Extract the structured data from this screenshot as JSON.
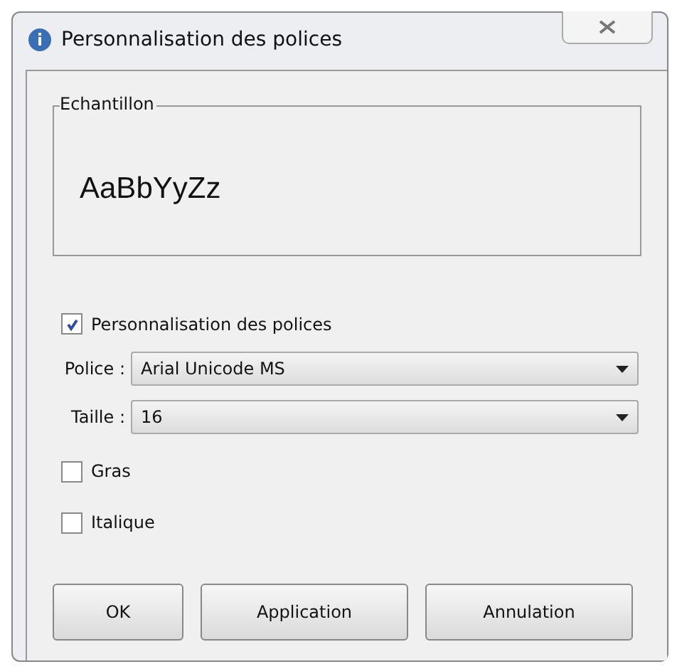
{
  "window": {
    "title": "Personnalisation des polices"
  },
  "sample": {
    "legend": "Echantillon",
    "text": "AaBbYyZz"
  },
  "custom_fonts": {
    "label": "Personnalisation des polices",
    "checked": true
  },
  "fields": [
    {
      "label": "Police :",
      "value": "Arial Unicode MS"
    },
    {
      "label": "Taille :",
      "value": "16"
    }
  ],
  "options": [
    {
      "label": "Gras",
      "checked": false
    },
    {
      "label": "Italique",
      "checked": false
    }
  ],
  "buttons": [
    "OK",
    "Application",
    "Annulation"
  ]
}
